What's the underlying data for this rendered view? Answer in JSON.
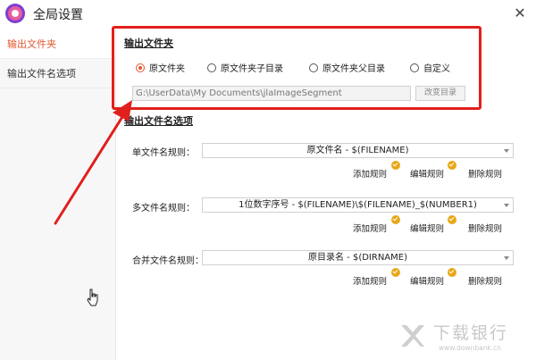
{
  "window": {
    "title": "全局设置",
    "close_glyph": "✕"
  },
  "sidebar": {
    "items": [
      {
        "label": "输出文件夹",
        "active": true
      },
      {
        "label": "输出文件名选项",
        "active": false
      }
    ]
  },
  "output_folder": {
    "section_title": "输出文件夹",
    "options": [
      {
        "label": "原文件夹",
        "checked": true
      },
      {
        "label": "原文件夹子目录",
        "checked": false
      },
      {
        "label": "原文件夹父目录",
        "checked": false
      },
      {
        "label": "自定义",
        "checked": false
      }
    ],
    "path_value": "G:\\UserData\\My Documents\\jlaImageSegment",
    "change_dir_label": "改变目录"
  },
  "filename_options": {
    "section_title": "输出文件名选项",
    "rules": [
      {
        "label": "单文件名规则：",
        "value": "原文件名 - $(FILENAME)",
        "actions": [
          "添加规则",
          "编辑规则",
          "删除规则"
        ]
      },
      {
        "label": "多文件名规则：",
        "value": "1位数字序号 - $(FILENAME)\\$(FILENAME)_$(NUMBER1)",
        "actions": [
          "添加规则",
          "编辑规则",
          "删除规则"
        ]
      },
      {
        "label": "合并文件名规则：",
        "value": "原目录名 - $(DIRNAME)",
        "actions": [
          "添加规则",
          "编辑规则",
          "删除规则"
        ]
      }
    ]
  },
  "watermark": {
    "text": "下载银行",
    "sub": "www.downbank.cn"
  },
  "colors": {
    "accent": "#e2562e",
    "highlight": "#e0201c",
    "badge": "#e8a818"
  }
}
